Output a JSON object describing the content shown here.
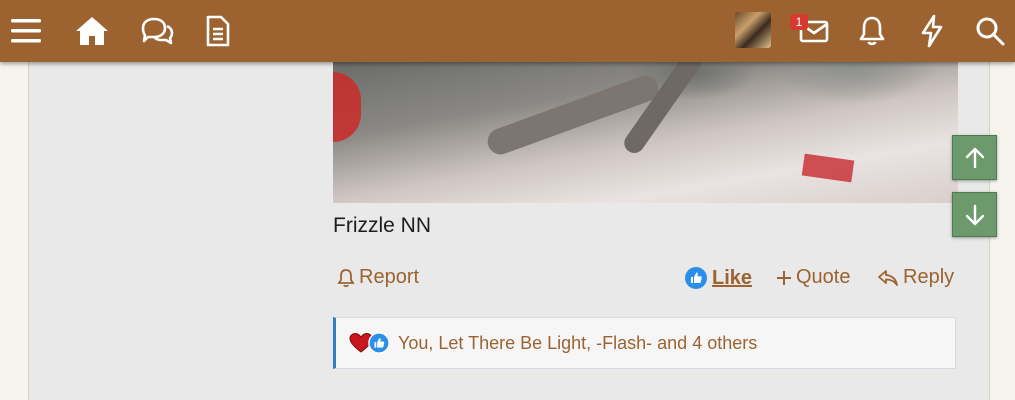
{
  "header": {
    "icons": [
      "menu-icon",
      "home-icon",
      "chat-bubbles-icon",
      "document-icon",
      "avatar",
      "inbox-icon",
      "bell-icon",
      "lightning-icon",
      "search-icon"
    ],
    "inbox_badge": "1",
    "bar_color": "#9c6331"
  },
  "post": {
    "caption": "Frizzle NN",
    "actions": {
      "report": "Report",
      "like": "Like",
      "quote": "Quote",
      "reply": "Reply"
    },
    "reactions": {
      "icons": [
        "heart-icon",
        "thumbs-up-icon"
      ],
      "text": "You, Let There Be Light, -Flash- and 4 others"
    }
  },
  "scroll": {
    "up_icon": "arrow-up-icon",
    "down_icon": "arrow-down-icon",
    "color": "#6d9a6c"
  }
}
